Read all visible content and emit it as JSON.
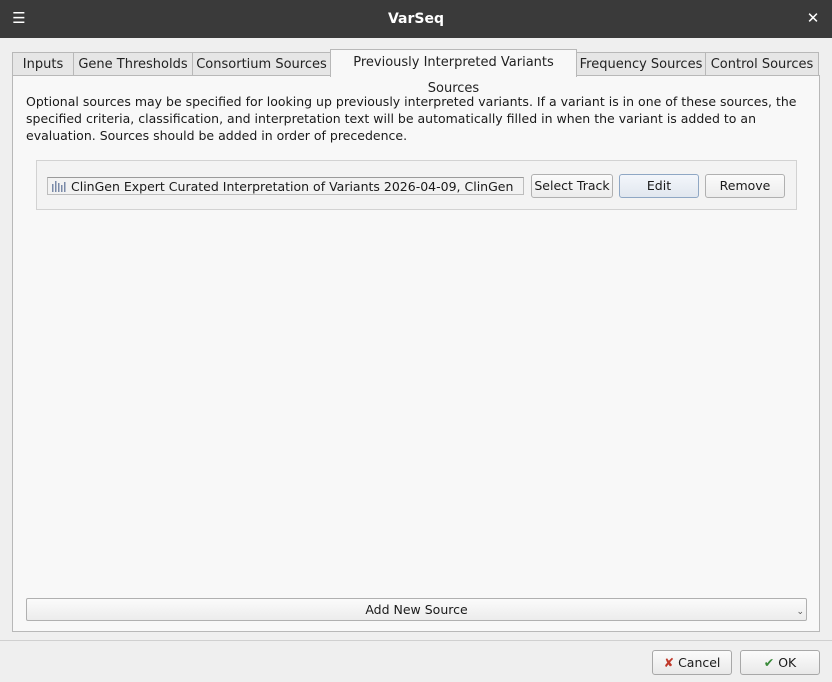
{
  "window": {
    "title": "VarSeq"
  },
  "tabs": [
    {
      "label": "Inputs",
      "active": false
    },
    {
      "label": "Gene Thresholds",
      "active": false
    },
    {
      "label": "Consortium Sources",
      "active": false
    },
    {
      "label": "Previously Interpreted Variants Sources",
      "active": true
    },
    {
      "label": "Frequency Sources",
      "active": false
    },
    {
      "label": "Control Sources",
      "active": false
    }
  ],
  "description": "Optional sources may be specified for looking up previously interpreted variants. If a variant is in one of these sources, the specified criteria, classification, and interpretation text will be automatically filled in when the variant is added to an evaluation. Sources should be added in order of precedence.",
  "source": {
    "label": "ClinGen Expert Curated Interpretation of Variants 2026-04-09, ClinGen",
    "icon": "track-bars-icon",
    "select_track_label": "Select Track",
    "edit_label": "Edit",
    "remove_label": "Remove"
  },
  "add_new_source_label": "Add New Source",
  "footer": {
    "cancel_label": "Cancel",
    "ok_label": "OK"
  },
  "colors": {
    "titlebar": "#3a3a3a",
    "cancel_icon": "#c0392b",
    "ok_icon": "#3a8a3a"
  }
}
